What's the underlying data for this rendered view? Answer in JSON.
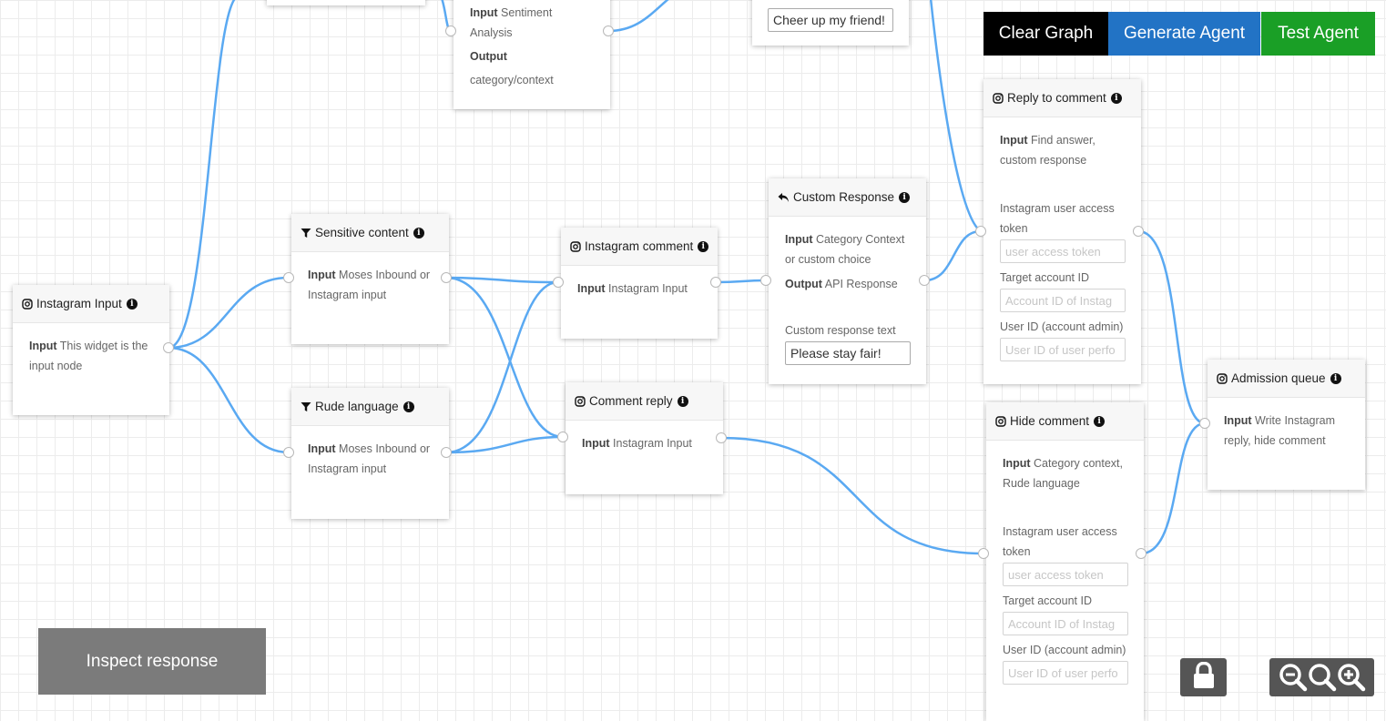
{
  "toolbar": {
    "clear_label": "Clear Graph",
    "generate_label": "Generate Agent",
    "test_label": "Test Agent",
    "colors": {
      "clear": "#000000",
      "generate": "#2273c5",
      "test": "#1a9f26"
    }
  },
  "inspect_label": "Inspect response",
  "nodes": {
    "top_right_snippet": {
      "input_value": "Cheer up my friend!"
    },
    "sentiment": {
      "input_label": "Input",
      "input_text": "Sentiment Analysis",
      "output_label": "Output",
      "output_text": "category/context"
    },
    "instagram_input": {
      "title": "Instagram Input",
      "icon": "instagram-icon",
      "input_label": "Input",
      "input_text": "This widget is the input node"
    },
    "sensitive_content": {
      "title": "Sensitive content",
      "icon": "filter-icon",
      "input_label": "Input",
      "input_text": "Moses Inbound or Instagram input"
    },
    "rude_language": {
      "title": "Rude language",
      "icon": "filter-icon",
      "input_label": "Input",
      "input_text": "Moses Inbound or Instagram input"
    },
    "instagram_comment": {
      "title": "Instagram comment",
      "icon": "instagram-icon",
      "input_label": "Input",
      "input_text": "Instagram Input"
    },
    "comment_reply": {
      "title": "Comment reply",
      "icon": "instagram-icon",
      "input_label": "Input",
      "input_text": "Instagram Input"
    },
    "custom_response": {
      "title": "Custom Response",
      "icon": "reply-icon",
      "input_label": "Input",
      "input_text": "Category Context or custom choice",
      "output_label": "Output",
      "output_text": "API Response",
      "field_label": "Custom response text",
      "field_value": "Please stay fair!"
    },
    "reply_to_comment": {
      "title": "Reply to comment",
      "icon": "instagram-icon",
      "input_label": "Input",
      "input_text": "Find answer, custom response",
      "token_label": "Instagram user access token",
      "token_placeholder": "user access token",
      "target_label": "Target account ID",
      "target_placeholder": "Account ID of Instag",
      "user_label": "User ID (account admin)",
      "user_placeholder": "User ID of user perfo"
    },
    "hide_comment": {
      "title": "Hide comment",
      "icon": "instagram-icon",
      "input_label": "Input",
      "input_text": "Category context, Rude language",
      "token_label": "Instagram user access token",
      "token_placeholder": "user access token",
      "target_label": "Target account ID",
      "target_placeholder": "Account ID of Instag",
      "user_label": "User ID (account admin)",
      "user_placeholder": "User ID of user perfo"
    },
    "admission_queue": {
      "title": "Admission queue",
      "icon": "instagram-icon",
      "input_label": "Input",
      "input_text": "Write Instagram reply, hide comment"
    }
  },
  "controls": {
    "lock": "lock-icon",
    "zoom": [
      "zoom-out-icon",
      "zoom-reset-icon",
      "zoom-in-icon"
    ]
  },
  "wire_color": "#5aa9f2"
}
